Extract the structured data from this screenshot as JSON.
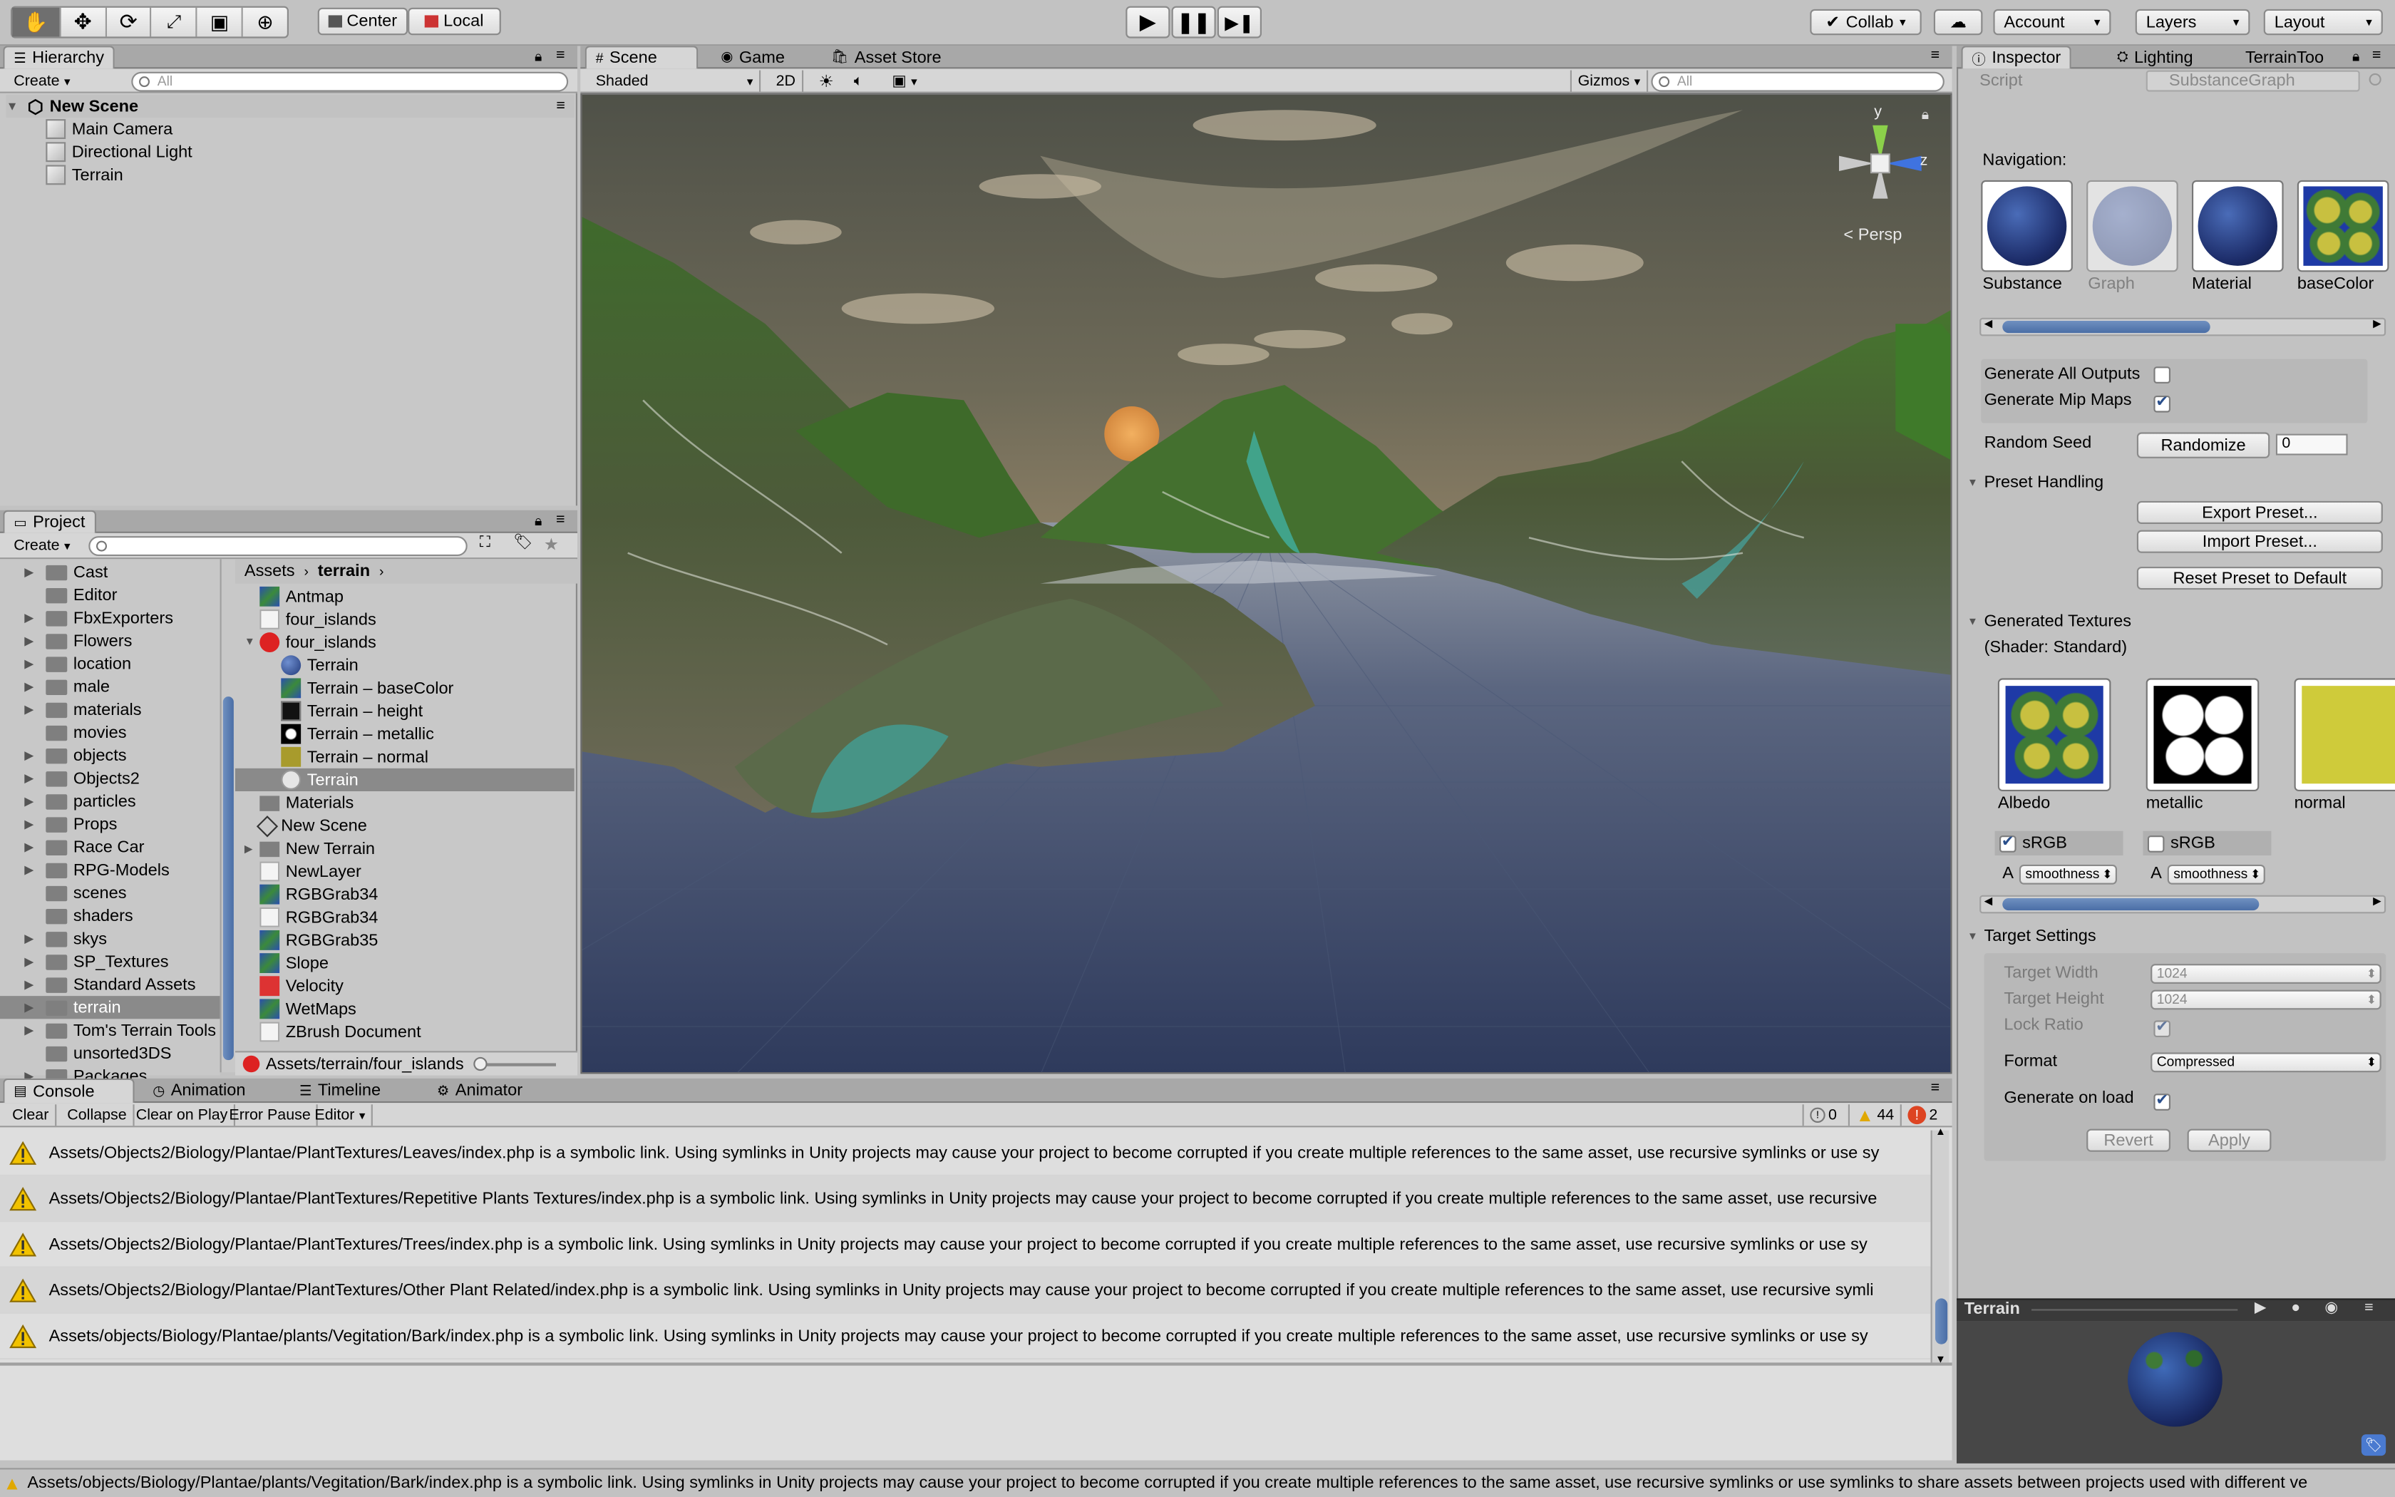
{
  "toolbar": {
    "center": "Center",
    "local": "Local",
    "collab": "Collab",
    "account": "Account",
    "layers": "Layers",
    "layout": "Layout",
    "tools": [
      "hand-tool-icon",
      "move-tool-icon",
      "rotate-tool-icon",
      "scale-tool-icon",
      "rect-tool-icon",
      "transform-tool-icon"
    ]
  },
  "hierarchy": {
    "tab": "Hierarchy",
    "create": "Create",
    "search": "All",
    "scene": "New Scene",
    "items": [
      "Main Camera",
      "Directional Light",
      "Terrain"
    ]
  },
  "project": {
    "tab": "Project",
    "create": "Create",
    "folders": [
      "Cast",
      "Editor",
      "FbxExporters",
      "Flowers",
      "location",
      "male",
      "materials",
      "movies",
      "objects",
      "Objects2",
      "particles",
      "Props",
      "Race Car",
      "RPG-Models",
      "scenes",
      "shaders",
      "skys",
      "SP_Textures",
      "Standard Assets",
      "terrain",
      "Tom's Terrain Tools",
      "unsorted3DS",
      "Packages"
    ],
    "breadcrumb": [
      "Assets",
      "terrain"
    ],
    "assets": [
      {
        "name": "Antmap",
        "indent": 0,
        "icon": "texture"
      },
      {
        "name": "four_islands",
        "indent": 0,
        "icon": "file"
      },
      {
        "name": "four_islands",
        "indent": 0,
        "icon": "substance",
        "expanded": true
      },
      {
        "name": "Terrain",
        "indent": 1,
        "icon": "material"
      },
      {
        "name": "Terrain – baseColor",
        "indent": 1,
        "icon": "texture"
      },
      {
        "name": "Terrain – height",
        "indent": 1,
        "icon": "height"
      },
      {
        "name": "Terrain – metallic",
        "indent": 1,
        "icon": "metallic"
      },
      {
        "name": "Terrain – normal",
        "indent": 1,
        "icon": "normal"
      },
      {
        "name": "Terrain",
        "indent": 1,
        "icon": "graph",
        "selected": true
      },
      {
        "name": "Materials",
        "indent": 0,
        "icon": "folder"
      },
      {
        "name": "New Scene",
        "indent": 0,
        "icon": "scene"
      },
      {
        "name": "New Terrain",
        "indent": 0,
        "icon": "folder",
        "collapsed": true
      },
      {
        "name": "NewLayer",
        "indent": 0,
        "icon": "file"
      },
      {
        "name": "RGBGrab34",
        "indent": 0,
        "icon": "texture"
      },
      {
        "name": "RGBGrab34",
        "indent": 0,
        "icon": "file"
      },
      {
        "name": "RGBGrab35",
        "indent": 0,
        "icon": "texture"
      },
      {
        "name": "Slope",
        "indent": 0,
        "icon": "texture"
      },
      {
        "name": "Velocity",
        "indent": 0,
        "icon": "red"
      },
      {
        "name": "WetMaps",
        "indent": 0,
        "icon": "texture"
      },
      {
        "name": "ZBrush Document",
        "indent": 0,
        "icon": "file"
      }
    ],
    "path": "Assets/terrain/four_islands"
  },
  "scene": {
    "tabs": [
      "Scene",
      "Game",
      "Asset Store"
    ],
    "shading": "Shaded",
    "mode2d": "2D",
    "gizmos": "Gizmos",
    "search": "All",
    "persp": "Persp",
    "axis": {
      "y": "y",
      "z": "z"
    }
  },
  "inspector": {
    "tabs": [
      "Inspector",
      "Lighting",
      "TerrainToo"
    ],
    "script_label": "Script",
    "script_value": "SubstanceGraph",
    "navigation_label": "Navigation:",
    "nav": [
      "Substance",
      "Graph",
      "Material",
      "baseColor"
    ],
    "generate_all_outputs": "Generate All Outputs",
    "generate_mip_maps": "Generate Mip Maps",
    "random_seed": "Random Seed",
    "randomize": "Randomize",
    "seed_value": "0",
    "preset_handling": "Preset Handling",
    "export_preset": "Export Preset...",
    "import_preset": "Import Preset...",
    "reset_preset": "Reset Preset to Default",
    "generated_textures": "Generated Textures",
    "shader": "(Shader: Standard)",
    "textures": [
      "Albedo",
      "metallic",
      "normal"
    ],
    "srgb": "sRGB",
    "a_label": "A",
    "smoothness": "smoothness",
    "target_settings": "Target Settings",
    "target_width": "Target Width",
    "target_width_val": "1024",
    "target_height": "Target Height",
    "target_height_val": "1024",
    "lock_ratio": "Lock Ratio",
    "format": "Format",
    "format_val": "Compressed",
    "generate_on_load": "Generate on load",
    "revert": "Revert",
    "apply": "Apply",
    "preview_title": "Terrain"
  },
  "console": {
    "tabs": [
      "Console",
      "Animation",
      "Timeline",
      "Animator"
    ],
    "buttons": [
      "Clear",
      "Collapse",
      "Clear on Play",
      "Error Pause",
      "Editor"
    ],
    "info_count": "0",
    "warn_count": "44",
    "error_count": "2",
    "messages": [
      "Assets/Objects2/Biology/Plantae/PlantTextures/Leaves/index.php is a symbolic link. Using symlinks in Unity projects may cause your project to become corrupted if you create multiple references to the same asset, use recursive symlinks or use sy",
      "Assets/Objects2/Biology/Plantae/PlantTextures/Repetitive Plants Textures/index.php is a symbolic link. Using symlinks in Unity projects may cause your project to become corrupted if you create multiple references to the same asset, use recursive",
      "Assets/Objects2/Biology/Plantae/PlantTextures/Trees/index.php is a symbolic link. Using symlinks in Unity projects may cause your project to become corrupted if you create multiple references to the same asset, use recursive symlinks or use sy",
      "Assets/Objects2/Biology/Plantae/PlantTextures/Other Plant Related/index.php is a symbolic link. Using symlinks in Unity projects may cause your project to become corrupted if you create multiple references to the same asset, use recursive symli",
      "Assets/objects/Biology/Plantae/plants/Vegitation/Bark/index.php is a symbolic link. Using symlinks in Unity projects may cause your project to become corrupted if you create multiple references to the same asset, use recursive symlinks or use sy"
    ]
  },
  "statusbar": "Assets/objects/Biology/Plantae/plants/Vegitation/Bark/index.php is a symbolic link. Using symlinks in Unity projects may cause your project to become corrupted if you create multiple references to the same asset, use recursive symlinks or use symlinks to share assets between projects used with different ve"
}
